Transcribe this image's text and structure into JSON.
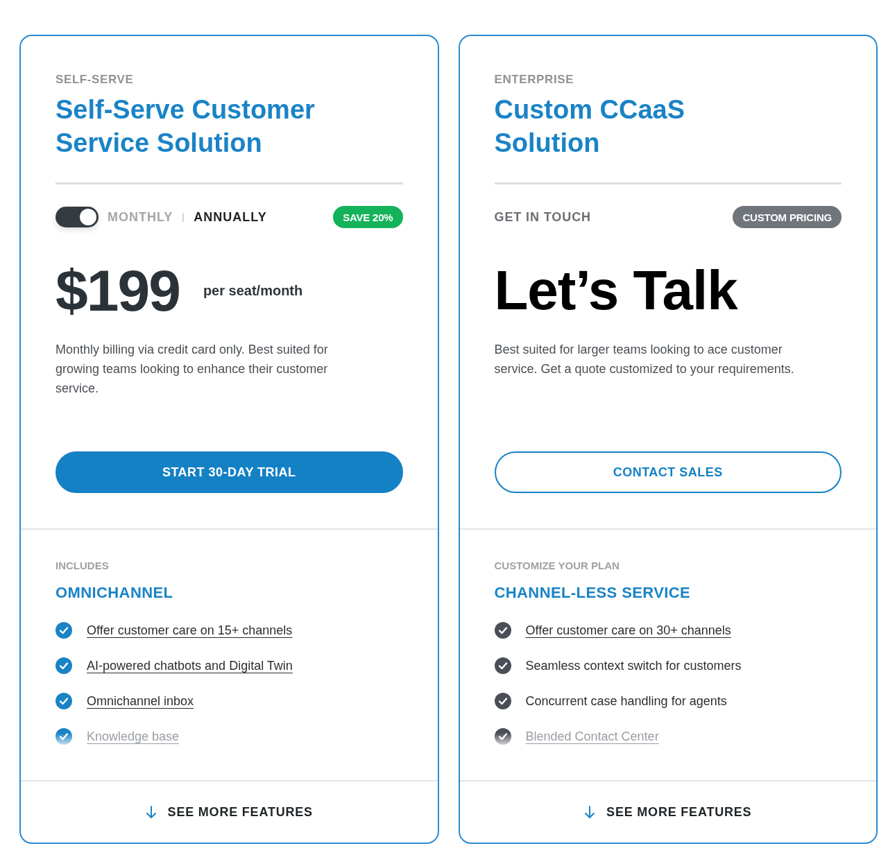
{
  "plans": [
    {
      "category": "SELF-SERVE",
      "title": "Self-Serve Customer Service Solution",
      "billing_toggle": {
        "on": true,
        "options": [
          {
            "label": "MONTHLY",
            "selected": false
          },
          {
            "label": "ANNUALLY",
            "selected": true
          }
        ]
      },
      "badge": {
        "text": "SAVE 20%",
        "color": "#14b25a"
      },
      "price": {
        "amount": "$199",
        "unit": "per seat/month"
      },
      "description": "Monthly billing via credit card only. Best suited for growing teams looking to enhance their customer service.",
      "cta": {
        "label": "START 30-DAY TRIAL",
        "kind": "filled"
      },
      "features": {
        "label": "INCLUDES",
        "heading": "OMNICHANNEL",
        "items": [
          {
            "text": "Offer customer care on 15+ channels",
            "link": true,
            "faded": false,
            "color": "#1a83c6"
          },
          {
            "text": "AI-powered chatbots and Digital Twin",
            "link": true,
            "faded": false,
            "color": "#1a83c6"
          },
          {
            "text": "Omnichannel inbox",
            "link": true,
            "faded": false,
            "color": "#1a83c6"
          },
          {
            "text": "Knowledge base",
            "link": true,
            "faded": true,
            "color": "#1a83c6"
          }
        ]
      },
      "see_more": "SEE MORE FEATURES"
    },
    {
      "category": "ENTERPRISE",
      "title": "Custom CCaaS Solution",
      "offer_label": "GET IN TOUCH",
      "badge": {
        "text": "CUSTOM PRICING",
        "color": "#6f757b"
      },
      "headline": "Let’s Talk",
      "description": "Best suited for larger teams looking to ace customer service. Get a quote customized to your requirements.",
      "cta": {
        "label": "CONTACT SALES",
        "kind": "outline"
      },
      "features": {
        "label": "CUSTOMIZE YOUR PLAN",
        "heading": "CHANNEL-LESS SERVICE",
        "items": [
          {
            "text": "Offer customer care on 30+ channels",
            "link": true,
            "faded": false,
            "color": "#4b4e56"
          },
          {
            "text": "Seamless context switch for customers",
            "link": false,
            "faded": false,
            "color": "#4b4e56"
          },
          {
            "text": "Concurrent case handling for agents",
            "link": false,
            "faded": false,
            "color": "#4b4e56"
          },
          {
            "text": "Blended Contact Center",
            "link": true,
            "faded": true,
            "color": "#4b4e56"
          }
        ]
      },
      "see_more": "SEE MORE FEATURES"
    }
  ]
}
